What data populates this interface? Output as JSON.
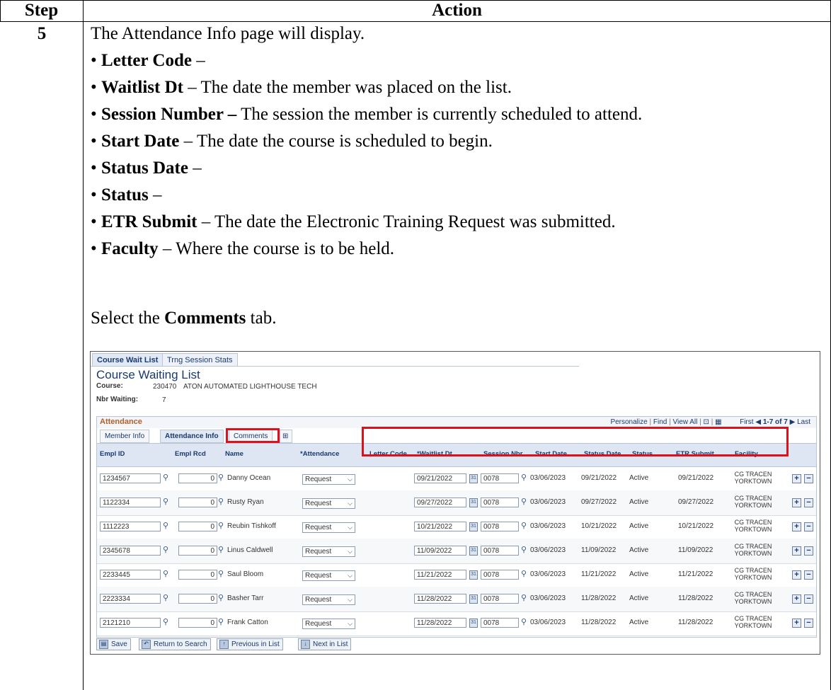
{
  "table": {
    "header_step": "Step",
    "header_action": "Action",
    "step_number": "5",
    "intro": "The Attendance Info page will display.",
    "bullets": [
      {
        "term": "Letter Code",
        "sep": " –",
        "desc": ""
      },
      {
        "term": "Waitlist Dt",
        "sep": " –",
        "desc": " The date the member was placed on the list."
      },
      {
        "term": "Session Number –",
        "sep": "",
        "desc": " The session the member is currently scheduled to attend."
      },
      {
        "term": "Start Date",
        "sep": " –",
        "desc": " The date the course is scheduled to begin."
      },
      {
        "term": "Status Date",
        "sep": " –",
        "desc": ""
      },
      {
        "term": "Status",
        "sep": " –",
        "desc": ""
      },
      {
        "term": "ETR Submit",
        "sep": " –",
        "desc": " The date the Electronic Training Request was submitted."
      },
      {
        "term": "Faculty",
        "sep": " –",
        "desc": " Where the course is to be held."
      }
    ],
    "select_prefix": "Select the ",
    "select_term": "Comments",
    "select_suffix": " tab."
  },
  "screenshot": {
    "top_tabs": [
      "Course Wait List",
      "Trng Session Stats"
    ],
    "page_title": "Course Waiting List",
    "course_label": "Course:",
    "course_code": "230470",
    "course_name": "ATON AUTOMATED LIGHTHOUSE TECH",
    "nbr_waiting_label": "Nbr Waiting:",
    "nbr_waiting": "7",
    "grid_title": "Attendance",
    "grid_nav": {
      "personalize": "Personalize",
      "find": "Find",
      "view_all": "View All",
      "first": "First",
      "range": "1-7 of 7",
      "last": "Last"
    },
    "grid_tabs": [
      "Member Info",
      "Attendance Info",
      "Comments"
    ],
    "columns": [
      "Empl ID",
      "Empl Rcd",
      "Name",
      "*Attendance",
      "Letter Code",
      "*Waitlist Dt",
      "Session Nbr",
      "Start Date",
      "Status Date",
      "Status",
      "ETR Submit",
      "Facility"
    ],
    "rows": [
      {
        "emplid": "1234567",
        "rcd": "0",
        "name": "Danny Ocean",
        "attendance": "Request",
        "letter": "",
        "waitlist": "09/21/2022",
        "session": "0078",
        "start": "03/06/2023",
        "status_date": "09/21/2022",
        "status": "Active",
        "etr": "09/21/2022",
        "facility1": "CG TRACEN",
        "facility2": "YORKTOWN"
      },
      {
        "emplid": "1122334",
        "rcd": "0",
        "name": "Rusty Ryan",
        "attendance": "Request",
        "letter": "",
        "waitlist": "09/27/2022",
        "session": "0078",
        "start": "03/06/2023",
        "status_date": "09/27/2022",
        "status": "Active",
        "etr": "09/27/2022",
        "facility1": "CG TRACEN",
        "facility2": "YORKTOWN"
      },
      {
        "emplid": "1112223",
        "rcd": "0",
        "name": "Reubin Tishkoff",
        "attendance": "Request",
        "letter": "",
        "waitlist": "10/21/2022",
        "session": "0078",
        "start": "03/06/2023",
        "status_date": "10/21/2022",
        "status": "Active",
        "etr": "10/21/2022",
        "facility1": "CG TRACEN",
        "facility2": "YORKTOWN"
      },
      {
        "emplid": "2345678",
        "rcd": "0",
        "name": "Linus Caldwell",
        "attendance": "Request",
        "letter": "",
        "waitlist": "11/09/2022",
        "session": "0078",
        "start": "03/06/2023",
        "status_date": "11/09/2022",
        "status": "Active",
        "etr": "11/09/2022",
        "facility1": "CG TRACEN",
        "facility2": "YORKTOWN"
      },
      {
        "emplid": "2233445",
        "rcd": "0",
        "name": "Saul Bloom",
        "attendance": "Request",
        "letter": "",
        "waitlist": "11/21/2022",
        "session": "0078",
        "start": "03/06/2023",
        "status_date": "11/21/2022",
        "status": "Active",
        "etr": "11/21/2022",
        "facility1": "CG TRACEN",
        "facility2": "YORKTOWN"
      },
      {
        "emplid": "2223334",
        "rcd": "0",
        "name": "Basher Tarr",
        "attendance": "Request",
        "letter": "",
        "waitlist": "11/28/2022",
        "session": "0078",
        "start": "03/06/2023",
        "status_date": "11/28/2022",
        "status": "Active",
        "etr": "11/28/2022",
        "facility1": "CG TRACEN",
        "facility2": "YORKTOWN"
      },
      {
        "emplid": "2121210",
        "rcd": "0",
        "name": "Frank Catton",
        "attendance": "Request",
        "letter": "",
        "waitlist": "11/28/2022",
        "session": "0078",
        "start": "03/06/2023",
        "status_date": "11/28/2022",
        "status": "Active",
        "etr": "11/28/2022",
        "facility1": "CG TRACEN",
        "facility2": "YORKTOWN"
      }
    ],
    "buttons": [
      "Save",
      "Return to Search",
      "Previous in List",
      "Next in List"
    ],
    "highlight_color": "#e0101a"
  }
}
